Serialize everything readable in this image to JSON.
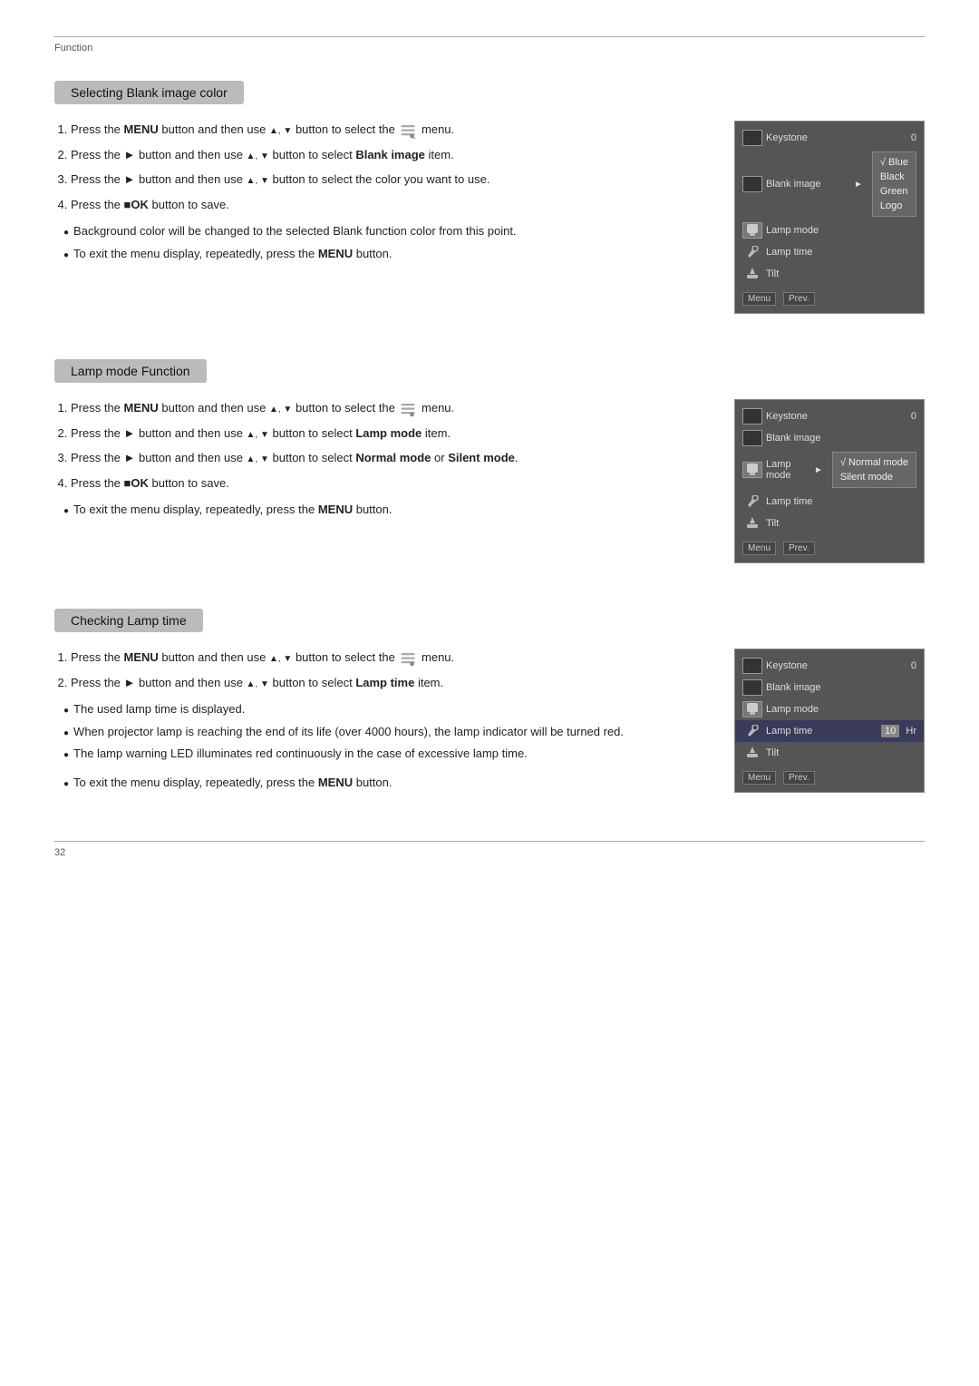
{
  "page": {
    "section_label": "Function",
    "page_number": "32"
  },
  "sections": [
    {
      "id": "blank-image",
      "header": "Selecting Blank image color",
      "steps": [
        {
          "text_before": "Press the ",
          "bold1": "MENU",
          "text_mid1": " button and then use ",
          "tri": "▲,▼",
          "text_mid2": " button to select the",
          "icon": "menu-icon",
          "text_after": "menu."
        },
        {
          "text_before": "Press the ► button and then use ",
          "tri": "▲,▼",
          "text_mid": " button to select ",
          "bold": "Blank image",
          "text_after": " item."
        },
        {
          "text_before": "Press the ► button and then use ",
          "tri": "▲,▼",
          "text_after": " button to select the color you want to use."
        },
        {
          "text_before": "Press the ",
          "bold": "■OK",
          "text_after": " button to save."
        }
      ],
      "bullets": [
        "Background color will be changed to the selected Blank function color from this point.",
        "To exit the menu display, repeatedly, press the MENU button."
      ],
      "bullets_bold": [
        "MENU"
      ],
      "menu": {
        "rows": [
          {
            "icon": "dark",
            "text": "Keystone",
            "value": "0",
            "selected": false
          },
          {
            "icon": "dark",
            "text": "Blank image",
            "arrow": "►",
            "selected": false
          },
          {
            "icon": "light",
            "text": "Lamp mode",
            "value": "",
            "selected": false
          },
          {
            "icon": "none",
            "text": "Lamp time",
            "value": "",
            "selected": false
          },
          {
            "icon": "none",
            "text": "Tilt",
            "value": "",
            "selected": false
          }
        ],
        "submenu": [
          "√ Blue",
          "Black",
          "Green",
          "Logo"
        ],
        "footer": [
          "Menu",
          "Prev."
        ]
      }
    },
    {
      "id": "lamp-mode",
      "header": "Lamp mode Function",
      "steps": [
        {
          "text_before": "Press the ",
          "bold1": "MENU",
          "text_mid1": " button and then use ",
          "tri": "▲,▼",
          "text_mid2": " button to select the",
          "icon": "menu-icon",
          "text_after": "menu."
        },
        {
          "text_before": "Press the ► button and then use ",
          "tri": "▲,▼",
          "text_mid": " button to select ",
          "bold": "Lamp mode",
          "text_after": " item."
        },
        {
          "text_before": "Press the ► button and then use ",
          "tri": "▲,▼",
          "text_mid": " button to select ",
          "bold": "Normal mode",
          "text_mid2": " or ",
          "bold2": "Silent mode",
          "text_after": "."
        },
        {
          "text_before": "Press the ",
          "bold": "■OK",
          "text_after": " button to save."
        }
      ],
      "bullets": [
        "To exit the menu display, repeatedly, press the MENU button."
      ],
      "bullets_bold": [
        "MENU"
      ],
      "menu": {
        "rows": [
          {
            "icon": "dark",
            "text": "Keystone",
            "value": "0",
            "selected": false
          },
          {
            "icon": "dark",
            "text": "Blank image",
            "value": "",
            "selected": false
          },
          {
            "icon": "light",
            "text": "Lamp mode",
            "arrow": "►",
            "selected": false
          },
          {
            "icon": "none",
            "text": "Lamp time",
            "value": "",
            "selected": false
          },
          {
            "icon": "none",
            "text": "Tilt",
            "value": "",
            "selected": false
          }
        ],
        "submenu": [
          "√ Normal mode",
          "Silent mode"
        ],
        "footer": [
          "Menu",
          "Prev."
        ]
      }
    },
    {
      "id": "lamp-time",
      "header": "Checking Lamp time",
      "steps": [
        {
          "text_before": "Press the ",
          "bold1": "MENU",
          "text_mid1": " button and then use ",
          "tri": "▲,▼",
          "text_mid2": " button to select the",
          "icon": "menu-icon",
          "text_after": "menu."
        },
        {
          "text_before": "Press the ► button and then use ",
          "tri": "▲,▼",
          "text_mid": " button to select ",
          "bold": "Lamp time",
          "text_after": " item."
        }
      ],
      "bullets": [
        "The used lamp time is displayed.",
        "When projector lamp is reaching the end of its life (over 4000 hours), the lamp indicator will be turned red.",
        "The lamp warning LED illuminates red continuously in the case of excessive lamp time."
      ],
      "single_bullet": "To exit the menu display, repeatedly, press the MENU button.",
      "single_bullet_bold": "MENU",
      "menu": {
        "rows": [
          {
            "icon": "dark",
            "text": "Keystone",
            "value": "0",
            "selected": false
          },
          {
            "icon": "dark",
            "text": "Blank image",
            "value": "",
            "selected": false
          },
          {
            "icon": "light",
            "text": "Lamp mode",
            "value": "",
            "selected": false
          },
          {
            "icon": "none",
            "text": "Lamp time",
            "value": "10  Hr",
            "selected": true
          },
          {
            "icon": "none",
            "text": "Tilt",
            "value": "",
            "selected": false
          }
        ],
        "submenu": [],
        "footer": [
          "Menu",
          "Prev."
        ]
      }
    }
  ]
}
